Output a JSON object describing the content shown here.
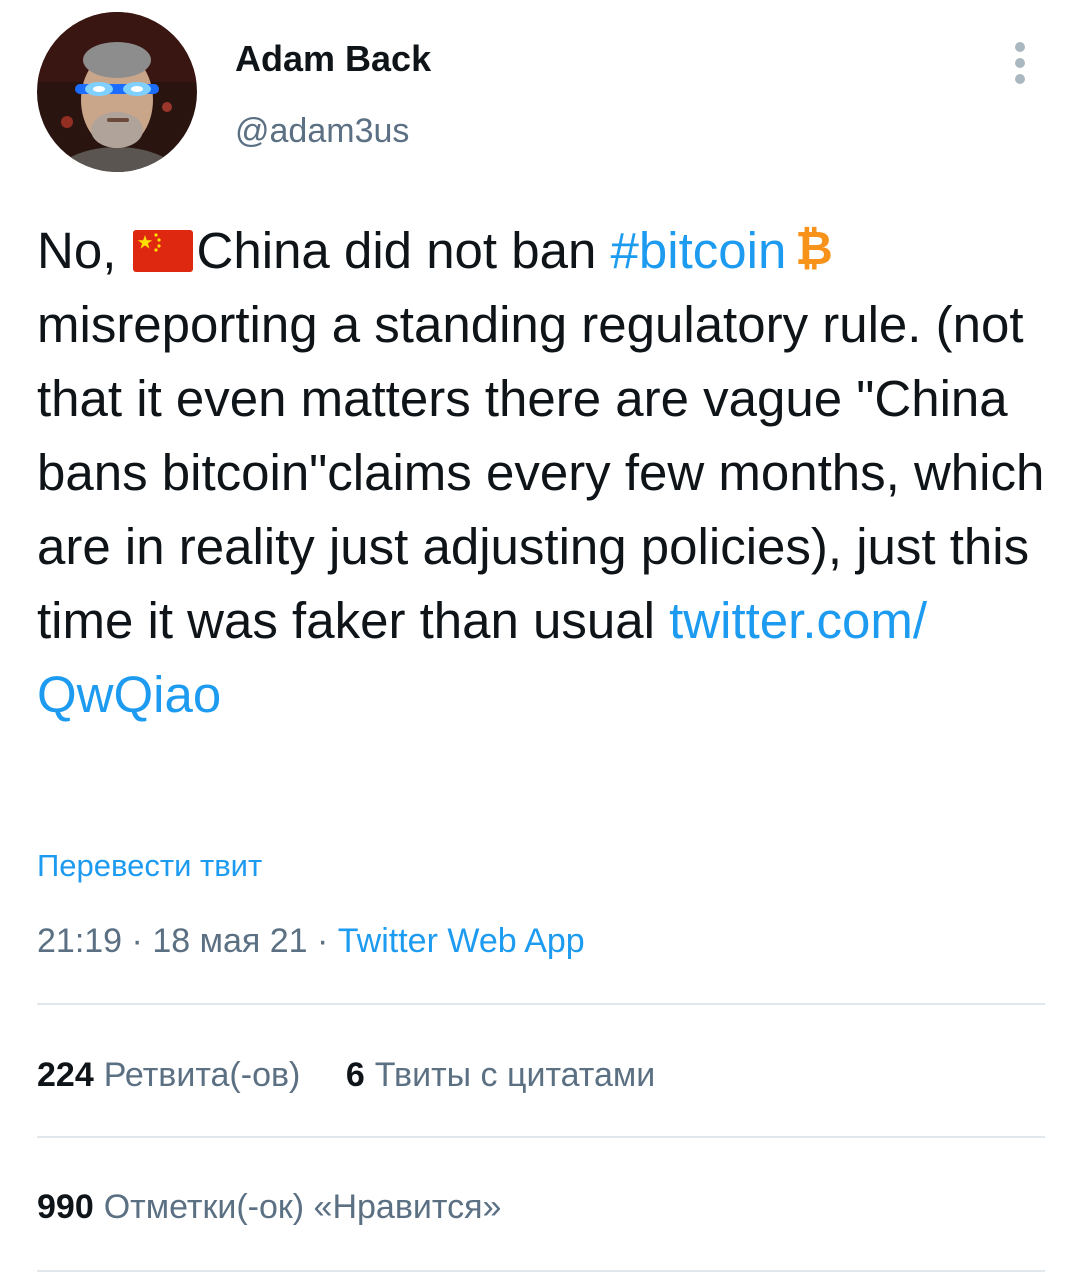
{
  "author": {
    "display_name": "Adam Back",
    "handle": "@adam3us"
  },
  "tweet": {
    "text_1": "No, ",
    "text_2": "China did not ban ",
    "hashtag": "#bitcoin",
    "text_3": "misreporting a standing regulatory rule. (not that it even matters there are vague \"China bans bitcoin\"claims every few months, which are in reality just adjusting policies), just this time it was faker than usual ",
    "link": "twitter.com/\nQwQiao"
  },
  "translate_label": "Перевести твит",
  "meta": {
    "time": "21:19",
    "separator": " · ",
    "date": "18 мая 21",
    "source": "Twitter Web App"
  },
  "stats": {
    "retweets_count": "224",
    "retweets_label": "Ретвита(-ов)",
    "quotes_count": "6",
    "quotes_label": "Твиты с цитатами",
    "likes_count": "990",
    "likes_label": "Отметки(-ок) «Нравится»"
  },
  "icons": {
    "flag": "china-flag-icon",
    "bitcoin": "bitcoin-icon",
    "more": "more-vertical-icon"
  },
  "colors": {
    "link": "#1d9bf0",
    "secondary_text": "#5b7083",
    "primary_text": "#0f1419",
    "divider": "#e1e8ed",
    "bitcoin": "#f7931a",
    "flag_red": "#de2910",
    "flag_yellow": "#ffde00"
  }
}
